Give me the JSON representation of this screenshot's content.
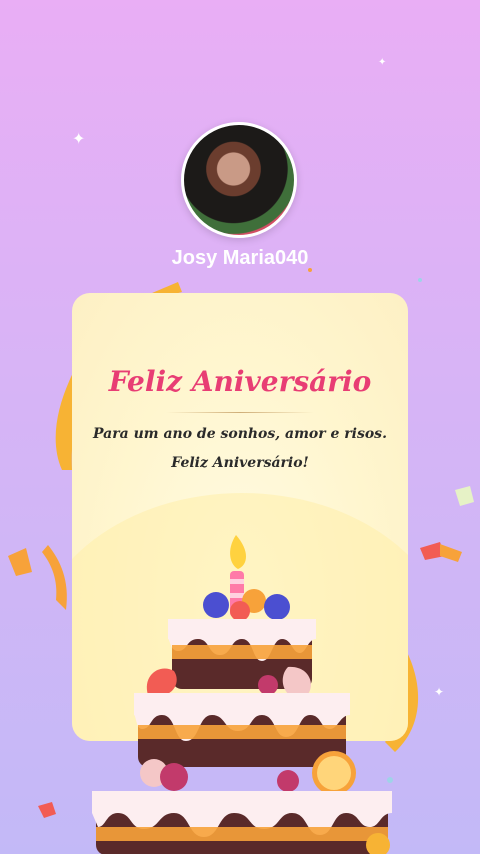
{
  "profile": {
    "username": "Josy Maria040"
  },
  "card": {
    "title": "Feliz Aniversário",
    "message_line1": "Para um ano de sonhos, amor e risos.",
    "message_line2": "Feliz Aniversário!"
  },
  "icons": {
    "sparkle": "sparkle-icon",
    "cake": "birthday-cake-illustration"
  },
  "colors": {
    "title": "#e83d74",
    "background_top": "#e9aef5",
    "background_bottom": "#c3b9f7",
    "card": "#fff6cf"
  }
}
